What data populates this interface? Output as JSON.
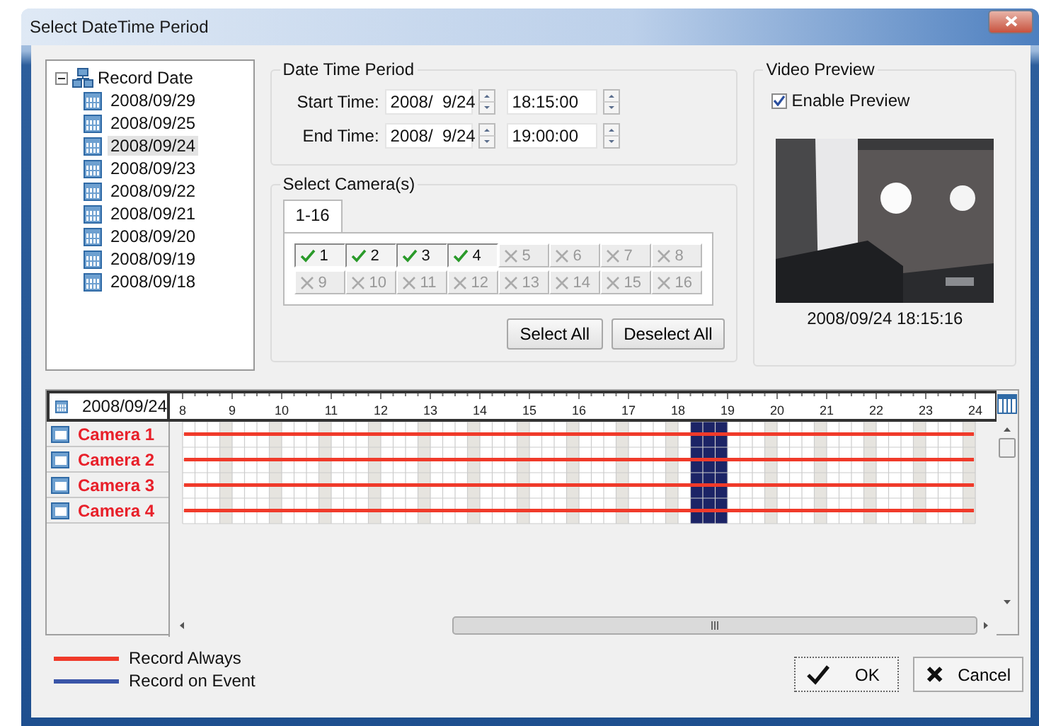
{
  "window": {
    "title": "Select DateTime Period"
  },
  "tree": {
    "root": {
      "label": "Record Date",
      "expanded": true
    },
    "items": [
      {
        "label": "2008/09/29",
        "selected": false
      },
      {
        "label": "2008/09/25",
        "selected": false
      },
      {
        "label": "2008/09/24",
        "selected": true
      },
      {
        "label": "2008/09/23",
        "selected": false
      },
      {
        "label": "2008/09/22",
        "selected": false
      },
      {
        "label": "2008/09/21",
        "selected": false
      },
      {
        "label": "2008/09/20",
        "selected": false
      },
      {
        "label": "2008/09/19",
        "selected": false
      },
      {
        "label": "2008/09/18",
        "selected": false
      }
    ]
  },
  "date_time_period": {
    "title": "Date Time Period",
    "rows": [
      {
        "label": "Start Time:",
        "date": "2008/  9/24",
        "time": "18:15:00"
      },
      {
        "label": "End Time:",
        "date": "2008/  9/24",
        "time": "19:00:00"
      }
    ]
  },
  "camera_select": {
    "title": "Select Camera(s)",
    "tabs": [
      {
        "label": "1-16",
        "selected": true
      }
    ],
    "cameras": [
      {
        "label": "1",
        "checked": true
      },
      {
        "label": "2",
        "checked": true
      },
      {
        "label": "3",
        "checked": true
      },
      {
        "label": "4",
        "checked": true
      },
      {
        "label": "5",
        "checked": false
      },
      {
        "label": "6",
        "checked": false
      },
      {
        "label": "7",
        "checked": false
      },
      {
        "label": "8",
        "checked": false
      },
      {
        "label": "9",
        "checked": false
      },
      {
        "label": "10",
        "checked": false
      },
      {
        "label": "11",
        "checked": false
      },
      {
        "label": "12",
        "checked": false
      },
      {
        "label": "13",
        "checked": false
      },
      {
        "label": "14",
        "checked": false
      },
      {
        "label": "15",
        "checked": false
      },
      {
        "label": "16",
        "checked": false
      }
    ],
    "buttons": [
      "Select All",
      "Deselect All"
    ]
  },
  "video_preview": {
    "title": "Video Preview",
    "enable_preview": {
      "label": "Enable Preview",
      "checked": true
    },
    "timestamp": "2008/09/24 18:15:16"
  },
  "timeline": {
    "date": "2008/09/24",
    "hour_labels": [
      "8",
      "9",
      "10",
      "11",
      "12",
      "13",
      "14",
      "15",
      "16",
      "17",
      "18",
      "19",
      "20",
      "21",
      "22",
      "23",
      "24"
    ],
    "hours": [
      {
        "quarters": [
          {
            "selected": false
          },
          {
            "selected": false
          },
          {
            "selected": false
          },
          {
            "selected": false
          }
        ]
      },
      {
        "quarters": [
          {
            "selected": false
          },
          {
            "selected": false
          },
          {
            "selected": false
          },
          {
            "selected": false
          }
        ]
      },
      {
        "quarters": [
          {
            "selected": false
          },
          {
            "selected": false
          },
          {
            "selected": false
          },
          {
            "selected": false
          }
        ]
      },
      {
        "quarters": [
          {
            "selected": false
          },
          {
            "selected": false
          },
          {
            "selected": false
          },
          {
            "selected": false
          }
        ]
      },
      {
        "quarters": [
          {
            "selected": false
          },
          {
            "selected": false
          },
          {
            "selected": false
          },
          {
            "selected": false
          }
        ]
      },
      {
        "quarters": [
          {
            "selected": false
          },
          {
            "selected": false
          },
          {
            "selected": false
          },
          {
            "selected": false
          }
        ]
      },
      {
        "quarters": [
          {
            "selected": false
          },
          {
            "selected": false
          },
          {
            "selected": false
          },
          {
            "selected": false
          }
        ]
      },
      {
        "quarters": [
          {
            "selected": false
          },
          {
            "selected": false
          },
          {
            "selected": false
          },
          {
            "selected": false
          }
        ]
      },
      {
        "quarters": [
          {
            "selected": false
          },
          {
            "selected": false
          },
          {
            "selected": false
          },
          {
            "selected": false
          }
        ]
      },
      {
        "quarters": [
          {
            "selected": false
          },
          {
            "selected": false
          },
          {
            "selected": false
          },
          {
            "selected": false
          }
        ]
      },
      {
        "quarters": [
          {
            "selected": false
          },
          {
            "selected": true
          },
          {
            "selected": true
          },
          {
            "selected": true
          }
        ]
      },
      {
        "quarters": [
          {
            "selected": false
          },
          {
            "selected": false
          },
          {
            "selected": false
          },
          {
            "selected": false
          }
        ]
      },
      {
        "quarters": [
          {
            "selected": false
          },
          {
            "selected": false
          },
          {
            "selected": false
          },
          {
            "selected": false
          }
        ]
      },
      {
        "quarters": [
          {
            "selected": false
          },
          {
            "selected": false
          },
          {
            "selected": false
          },
          {
            "selected": false
          }
        ]
      },
      {
        "quarters": [
          {
            "selected": false
          },
          {
            "selected": false
          },
          {
            "selected": false
          },
          {
            "selected": false
          }
        ]
      },
      {
        "quarters": [
          {
            "selected": false
          },
          {
            "selected": false
          },
          {
            "selected": false
          },
          {
            "selected": false
          }
        ]
      }
    ],
    "cameras": [
      {
        "name": "Camera 1",
        "kind": "always"
      },
      {
        "name": "Camera 2",
        "kind": "always"
      },
      {
        "name": "Camera 3",
        "kind": "always"
      },
      {
        "name": "Camera 4",
        "kind": "always"
      }
    ]
  },
  "legend": [
    {
      "label": "Record Always",
      "kind": "always",
      "color": "#f03a2a"
    },
    {
      "label": "Record on Event",
      "kind": "event",
      "color": "#3a55a8"
    }
  ],
  "buttons": [
    {
      "label": "OK",
      "kind": "ok"
    },
    {
      "label": "Cancel",
      "kind": "cancel"
    }
  ]
}
